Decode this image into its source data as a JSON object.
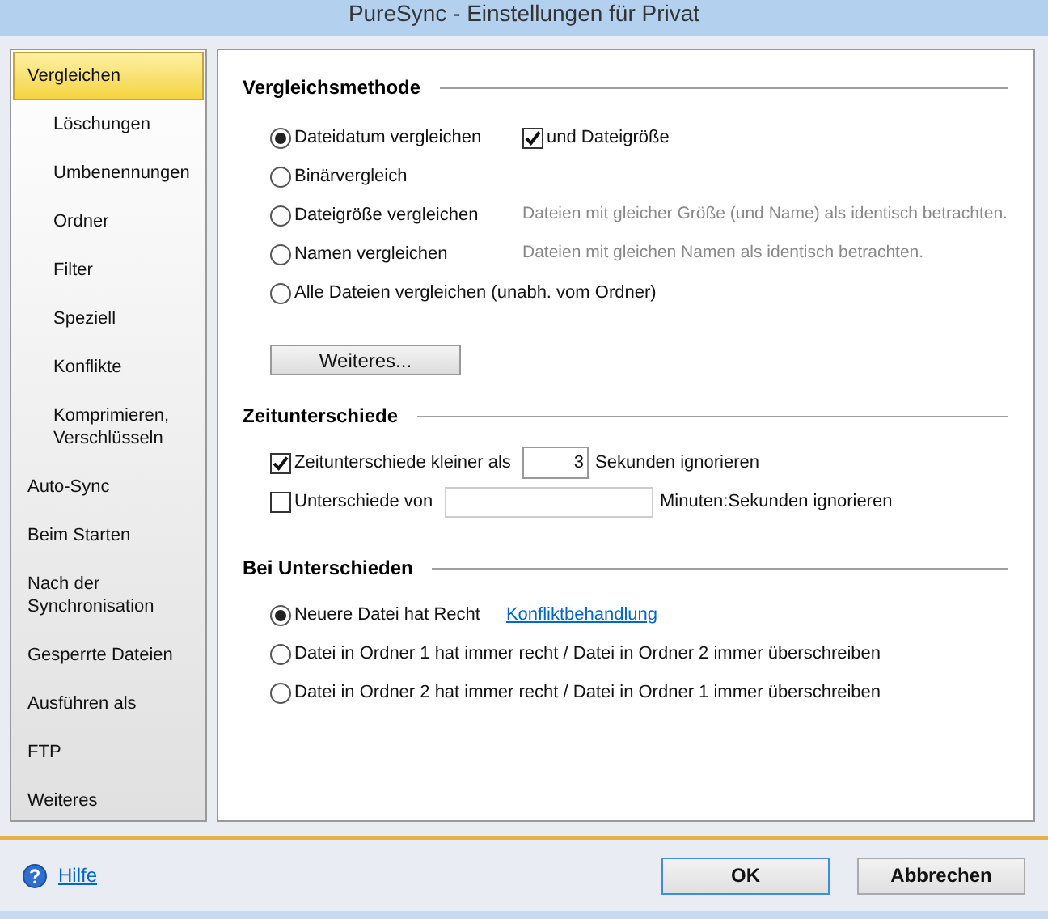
{
  "window": {
    "title": "PureSync - Einstellungen für Privat"
  },
  "sidebar": {
    "items": [
      {
        "label": "Vergleichen",
        "selected": true,
        "children": [
          {
            "label": "Löschungen",
            "selected": false
          },
          {
            "label": "Umbenennungen",
            "selected": false
          },
          {
            "label": "Ordner",
            "selected": false
          },
          {
            "label": "Filter",
            "selected": false
          },
          {
            "label": "Speziell",
            "selected": false
          },
          {
            "label": "Konflikte",
            "selected": false
          },
          {
            "label": "Komprimieren, Verschlüsseln",
            "selected": false
          }
        ]
      },
      {
        "label": "Auto-Sync",
        "selected": false
      },
      {
        "label": "Beim Starten",
        "selected": false
      },
      {
        "label": "Nach der Synchronisation",
        "selected": false
      },
      {
        "label": "Gesperrte Dateien",
        "selected": false
      },
      {
        "label": "Ausführen als",
        "selected": false
      },
      {
        "label": "FTP",
        "selected": false
      },
      {
        "label": "Weiteres",
        "selected": false
      }
    ]
  },
  "vergleichsmethode": {
    "title": "Vergleichsmethode",
    "options": [
      {
        "label": "Dateidatum vergleichen",
        "selected": true,
        "extra_checkbox": {
          "label": "und Dateigröße",
          "checked": true
        }
      },
      {
        "label": "Binärvergleich",
        "selected": false
      },
      {
        "label": "Dateigröße vergleichen",
        "selected": false,
        "hint": "Dateien mit gleicher Größe (und Name) als identisch betrachten."
      },
      {
        "label": "Namen vergleichen",
        "selected": false,
        "hint": "Dateien mit gleichen Namen als identisch betrachten."
      },
      {
        "label": "Alle Dateien vergleichen (unabh. vom Ordner)",
        "selected": false
      }
    ],
    "button": "Weiteres..."
  },
  "zeitunterschiede": {
    "title": "Zeitunterschiede",
    "rows": [
      {
        "label": "Zeitunterschiede kleiner als",
        "checked": true,
        "value": "3",
        "suffix": "Sekunden ignorieren",
        "kind": "short"
      },
      {
        "label": "Unterschiede von",
        "checked": false,
        "suffix": "Minuten:Sekunden ignorieren",
        "kind": "long"
      }
    ]
  },
  "bei_unterschieden": {
    "title": "Bei Unterschieden",
    "options": [
      {
        "label": "Neuere Datei hat Recht",
        "selected": true,
        "link": "Konfliktbehandlung"
      },
      {
        "label": "Datei in Ordner 1 hat immer recht / Datei in Ordner 2 immer überschreiben",
        "selected": false
      },
      {
        "label": "Datei in Ordner 2 hat immer recht / Datei in Ordner 1 immer überschreiben",
        "selected": false
      }
    ]
  },
  "footer": {
    "help_link": "Hilfe",
    "buttons": [
      "OK",
      "Abbrechen"
    ]
  }
}
